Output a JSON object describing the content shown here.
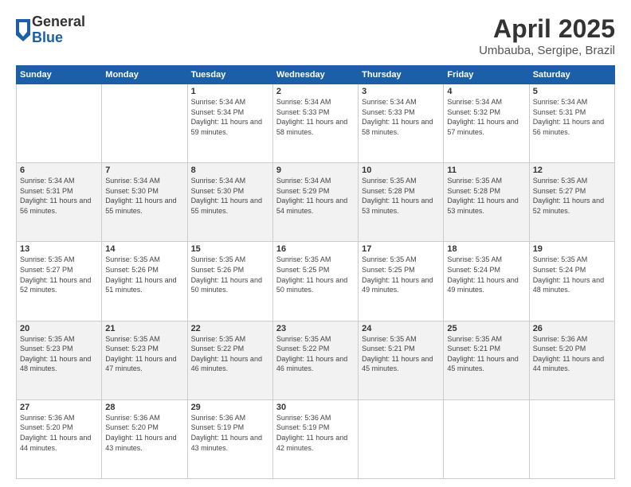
{
  "header": {
    "logo_general": "General",
    "logo_blue": "Blue",
    "title": "April 2025",
    "location": "Umbauba, Sergipe, Brazil"
  },
  "columns": [
    "Sunday",
    "Monday",
    "Tuesday",
    "Wednesday",
    "Thursday",
    "Friday",
    "Saturday"
  ],
  "weeks": [
    {
      "shade": "white",
      "days": [
        {
          "num": "",
          "info": ""
        },
        {
          "num": "",
          "info": ""
        },
        {
          "num": "1",
          "info": "Sunrise: 5:34 AM\nSunset: 5:34 PM\nDaylight: 11 hours\nand 59 minutes."
        },
        {
          "num": "2",
          "info": "Sunrise: 5:34 AM\nSunset: 5:33 PM\nDaylight: 11 hours\nand 58 minutes."
        },
        {
          "num": "3",
          "info": "Sunrise: 5:34 AM\nSunset: 5:33 PM\nDaylight: 11 hours\nand 58 minutes."
        },
        {
          "num": "4",
          "info": "Sunrise: 5:34 AM\nSunset: 5:32 PM\nDaylight: 11 hours\nand 57 minutes."
        },
        {
          "num": "5",
          "info": "Sunrise: 5:34 AM\nSunset: 5:31 PM\nDaylight: 11 hours\nand 56 minutes."
        }
      ]
    },
    {
      "shade": "shade",
      "days": [
        {
          "num": "6",
          "info": "Sunrise: 5:34 AM\nSunset: 5:31 PM\nDaylight: 11 hours\nand 56 minutes."
        },
        {
          "num": "7",
          "info": "Sunrise: 5:34 AM\nSunset: 5:30 PM\nDaylight: 11 hours\nand 55 minutes."
        },
        {
          "num": "8",
          "info": "Sunrise: 5:34 AM\nSunset: 5:30 PM\nDaylight: 11 hours\nand 55 minutes."
        },
        {
          "num": "9",
          "info": "Sunrise: 5:34 AM\nSunset: 5:29 PM\nDaylight: 11 hours\nand 54 minutes."
        },
        {
          "num": "10",
          "info": "Sunrise: 5:35 AM\nSunset: 5:28 PM\nDaylight: 11 hours\nand 53 minutes."
        },
        {
          "num": "11",
          "info": "Sunrise: 5:35 AM\nSunset: 5:28 PM\nDaylight: 11 hours\nand 53 minutes."
        },
        {
          "num": "12",
          "info": "Sunrise: 5:35 AM\nSunset: 5:27 PM\nDaylight: 11 hours\nand 52 minutes."
        }
      ]
    },
    {
      "shade": "white",
      "days": [
        {
          "num": "13",
          "info": "Sunrise: 5:35 AM\nSunset: 5:27 PM\nDaylight: 11 hours\nand 52 minutes."
        },
        {
          "num": "14",
          "info": "Sunrise: 5:35 AM\nSunset: 5:26 PM\nDaylight: 11 hours\nand 51 minutes."
        },
        {
          "num": "15",
          "info": "Sunrise: 5:35 AM\nSunset: 5:26 PM\nDaylight: 11 hours\nand 50 minutes."
        },
        {
          "num": "16",
          "info": "Sunrise: 5:35 AM\nSunset: 5:25 PM\nDaylight: 11 hours\nand 50 minutes."
        },
        {
          "num": "17",
          "info": "Sunrise: 5:35 AM\nSunset: 5:25 PM\nDaylight: 11 hours\nand 49 minutes."
        },
        {
          "num": "18",
          "info": "Sunrise: 5:35 AM\nSunset: 5:24 PM\nDaylight: 11 hours\nand 49 minutes."
        },
        {
          "num": "19",
          "info": "Sunrise: 5:35 AM\nSunset: 5:24 PM\nDaylight: 11 hours\nand 48 minutes."
        }
      ]
    },
    {
      "shade": "shade",
      "days": [
        {
          "num": "20",
          "info": "Sunrise: 5:35 AM\nSunset: 5:23 PM\nDaylight: 11 hours\nand 48 minutes."
        },
        {
          "num": "21",
          "info": "Sunrise: 5:35 AM\nSunset: 5:23 PM\nDaylight: 11 hours\nand 47 minutes."
        },
        {
          "num": "22",
          "info": "Sunrise: 5:35 AM\nSunset: 5:22 PM\nDaylight: 11 hours\nand 46 minutes."
        },
        {
          "num": "23",
          "info": "Sunrise: 5:35 AM\nSunset: 5:22 PM\nDaylight: 11 hours\nand 46 minutes."
        },
        {
          "num": "24",
          "info": "Sunrise: 5:35 AM\nSunset: 5:21 PM\nDaylight: 11 hours\nand 45 minutes."
        },
        {
          "num": "25",
          "info": "Sunrise: 5:35 AM\nSunset: 5:21 PM\nDaylight: 11 hours\nand 45 minutes."
        },
        {
          "num": "26",
          "info": "Sunrise: 5:36 AM\nSunset: 5:20 PM\nDaylight: 11 hours\nand 44 minutes."
        }
      ]
    },
    {
      "shade": "white",
      "days": [
        {
          "num": "27",
          "info": "Sunrise: 5:36 AM\nSunset: 5:20 PM\nDaylight: 11 hours\nand 44 minutes."
        },
        {
          "num": "28",
          "info": "Sunrise: 5:36 AM\nSunset: 5:20 PM\nDaylight: 11 hours\nand 43 minutes."
        },
        {
          "num": "29",
          "info": "Sunrise: 5:36 AM\nSunset: 5:19 PM\nDaylight: 11 hours\nand 43 minutes."
        },
        {
          "num": "30",
          "info": "Sunrise: 5:36 AM\nSunset: 5:19 PM\nDaylight: 11 hours\nand 42 minutes."
        },
        {
          "num": "",
          "info": ""
        },
        {
          "num": "",
          "info": ""
        },
        {
          "num": "",
          "info": ""
        }
      ]
    }
  ]
}
